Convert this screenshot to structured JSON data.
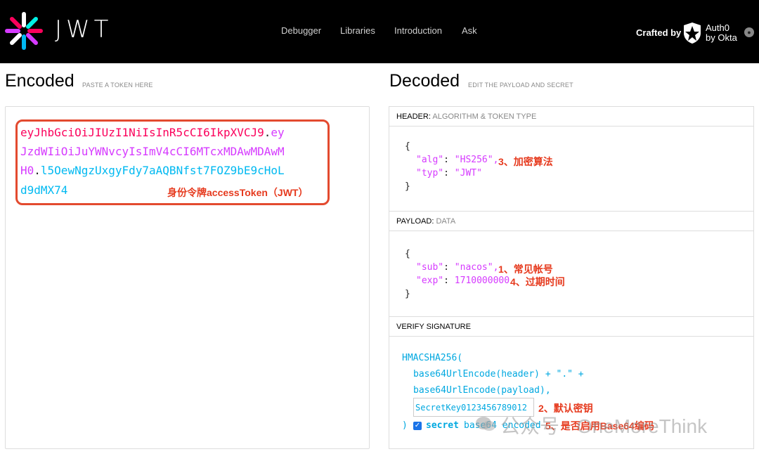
{
  "nav": {
    "brand": "JWT",
    "links": [
      "Debugger",
      "Libraries",
      "Introduction",
      "Ask"
    ],
    "crafted_by": "Crafted by",
    "auth0_line1": "Auth0",
    "auth0_line2": "by Okta"
  },
  "encoded": {
    "title": "Encoded",
    "subtitle": "PASTE A TOKEN HERE",
    "lines": [
      {
        "parts": [
          "eyJhbGciOiJIUzI1NiIsInR5cCI6IkpXVCJ9",
          ".",
          "ey"
        ]
      },
      {
        "parts": [
          "JzdWIiOiJuYWNvcyIsImV4cCI6MTcxMDAwMDAwM"
        ]
      },
      {
        "parts": [
          "H0",
          ".",
          "l5OewNgzUxgyFdy7aAQBNfst7FOZ9bE9cHoL"
        ]
      },
      {
        "parts": [
          "d9dMX74"
        ]
      }
    ],
    "note": "身份令牌accessToken（JWT）"
  },
  "decoded": {
    "title": "Decoded",
    "subtitle": "EDIT THE PAYLOAD AND SECRET",
    "header_label": "HEADER:",
    "header_sub": "ALGORITHM & TOKEN TYPE",
    "header_json": {
      "open": "{",
      "alg_key": "\"alg\"",
      "alg_val": "\"HS256\",",
      "typ_key": "\"typ\"",
      "typ_val": "\"JWT\"",
      "close": "}"
    },
    "note_alg": "3、加密算法",
    "payload_label": "PAYLOAD:",
    "payload_sub": "DATA",
    "payload_json": {
      "open": "{",
      "sub_key": "\"sub\"",
      "sub_val": "\"nacos\",",
      "exp_key": "\"exp\"",
      "exp_val": "1710000000",
      "close": "}"
    },
    "note_sub": "1、常见帐号",
    "note_exp": "4、过期时间",
    "verify_label": "VERIFY SIGNATURE",
    "sig_func": "HMACSHA256(",
    "sig_line1": "base64UrlEncode(header) + \".\" +",
    "sig_line2": "base64UrlEncode(payload),",
    "secret_value": "SecretKey0123456789012",
    "sig_close": ")",
    "secret_label": "secret",
    "base64_label": "base64 encoded",
    "note_secret": "2、默认密钥",
    "note_base64": "5、是否启用Base64编码",
    "watermark": "公众号 · OneMoreThink"
  },
  "colors": {
    "header_red": "#fb015b",
    "payload_purple": "#d63aff",
    "signature_blue": "#00b9f1",
    "annotation_red": "#e63a1e"
  }
}
